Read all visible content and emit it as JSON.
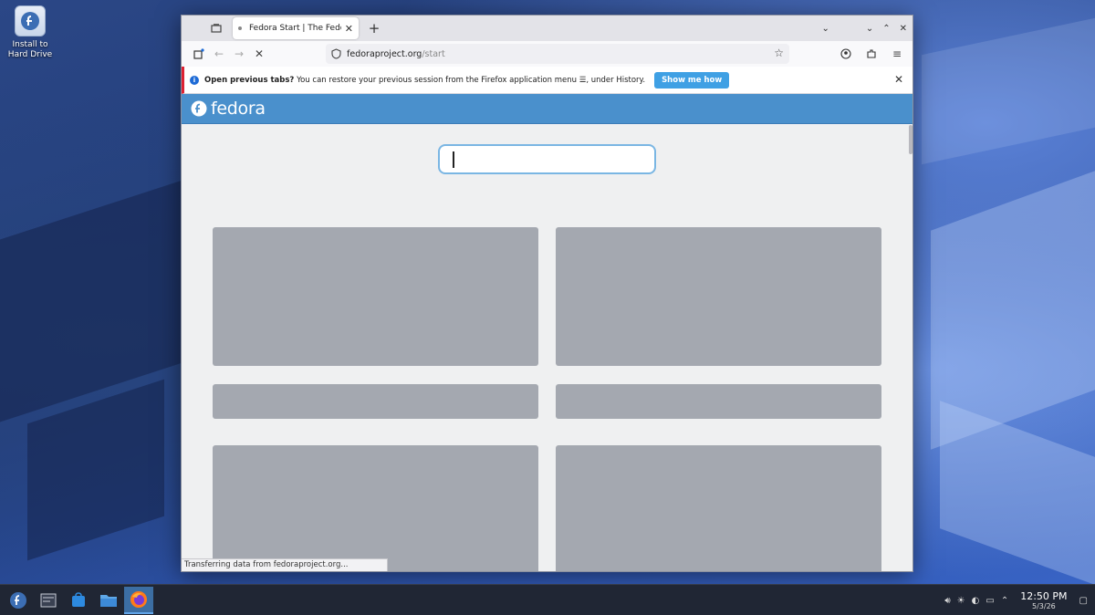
{
  "desktop": {
    "icon_label": "Install to Hard Drive"
  },
  "browser": {
    "tab": {
      "title": "Fedora Start | The Fedora"
    },
    "url": {
      "host": "fedoraproject.org",
      "path": "/start"
    },
    "infobar": {
      "bold_text": "Open previous tabs?",
      "text": " You can restore your previous session from the Firefox application menu ☰, under History.",
      "button_label": "Show me how"
    },
    "status_text": "Transferring data from fedoraproject.org..."
  },
  "page": {
    "brand": "fedora",
    "search": {
      "value": ""
    }
  },
  "taskbar": {
    "time": "12:50 PM",
    "date": "5/3/26"
  },
  "colors": {
    "fedora_blue": "#4a90cc",
    "show_me_how": "#3fa0e4",
    "taskbar": "#202634",
    "placeholder_card": "#a4a8b0"
  }
}
